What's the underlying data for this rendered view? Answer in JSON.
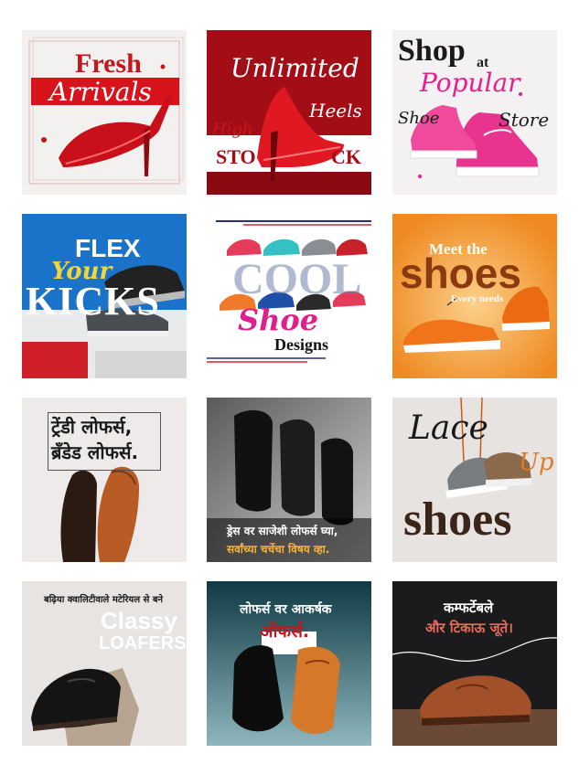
{
  "tiles": {
    "fresh": {
      "word1": "Fresh",
      "word2": "Arrivals"
    },
    "unlimited": {
      "title": "Unlimited",
      "high": "High",
      "heels": "Heels",
      "sto": "STO",
      "ck": "CK"
    },
    "popular": {
      "shop": "Shop",
      "at": "at",
      "popular": "Popular",
      "shoe": "Shoe",
      "store": "Store"
    },
    "flex": {
      "flex": "FLEX",
      "your": "Your",
      "kicks": "KICKS"
    },
    "cool": {
      "cool": "COOL",
      "shoe": "Shoe",
      "designs": "Designs"
    },
    "meet": {
      "meet": "Meet the",
      "shoes": "shoes",
      "every": "Every needs"
    },
    "trendy": {
      "line1": "ट्रेंडी लोफर्स,",
      "line2": "ब्रँडेड लोफर्स."
    },
    "dress": {
      "line1": "ड्रेस वर साजेशी लोफर्स घ्या,",
      "line2": "सर्वांच्या चर्चेचा विषय व्हा."
    },
    "lace": {
      "lace": "Lace",
      "up": "Up",
      "shoes": "shoes"
    },
    "classy": {
      "top": "बढ़िया क्वालिटीवाले मटेरियल से बने",
      "classy": "Classy",
      "loafers": "LOAFERS"
    },
    "offer": {
      "line1": "लोफर्स वर आकर्षक",
      "line2": "ऑफर्स."
    },
    "comfort": {
      "line1": "कम्फर्टेबले",
      "line2": "और टिकाऊ जूते।"
    }
  },
  "colors": {
    "red": "#c4161c",
    "maroon": "#9b0a12",
    "pink": "#e91e8c",
    "orange": "#f29a3a",
    "gold": "#f1b83a",
    "dark": "#1b1b1b"
  }
}
